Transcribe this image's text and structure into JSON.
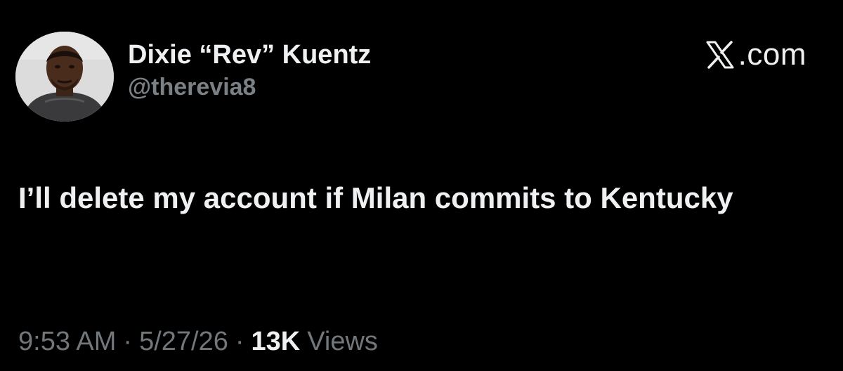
{
  "user": {
    "display_name": "Dixie “Rev” Kuentz",
    "handle": "@therevia8",
    "avatar_icon": "profile-photo"
  },
  "brand": {
    "icon": "x-logo-icon",
    "text": ".com"
  },
  "tweet": {
    "text": "I’ll delete my account if Milan commits to Kentucky"
  },
  "meta": {
    "time": "9:53 AM",
    "separator": "·",
    "date": "5/27/26",
    "views_count": "13K",
    "views_label": "Views"
  },
  "colors": {
    "background": "#000000",
    "primary_text": "#eef0f1",
    "secondary_text": "#72777c"
  }
}
